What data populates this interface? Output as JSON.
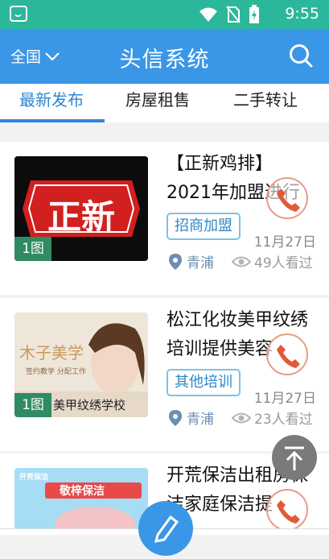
{
  "status": {
    "time": "9:55"
  },
  "header": {
    "region": "全国",
    "title": "头信系统"
  },
  "tabs": [
    "最新发布",
    "房屋租售",
    "二手转让"
  ],
  "posts": [
    {
      "title": "【正新鸡排】2021年加盟进行",
      "badge": "1图",
      "thumb_text": "正新",
      "category": "招商加盟",
      "date": "11月27日",
      "location": "青浦",
      "views": "49人看过"
    },
    {
      "title": "松江化妆美甲纹绣培训提供美容",
      "badge": "1图",
      "thumb_text": "木子美学",
      "thumb_sub": "签约教学 分配工作",
      "thumb_bottom": "美甲纹绣学校",
      "category": "其他培训",
      "date": "11月27日",
      "location": "青浦",
      "views": "23人看过"
    },
    {
      "title": "开荒保洁出租房保洁家庭保洁提",
      "thumb_text": "敬梓保洁",
      "thumb_corner": "开荒保洁"
    }
  ],
  "colors": {
    "status_bar": "#2bb89a",
    "header": "#3a96e6",
    "accent": "#2f86d4"
  }
}
